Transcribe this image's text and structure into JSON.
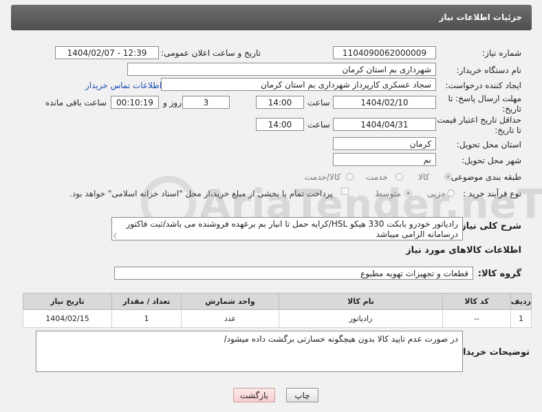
{
  "header": {
    "title": "جزئیات اطلاعات نیاز"
  },
  "watermark": {
    "text": "AriaTender.neT"
  },
  "form": {
    "need_number": {
      "label": "شماره نیاز:",
      "value": "1104090062000009"
    },
    "announce_datetime": {
      "label": "تاریخ و ساعت اعلان عمومی:",
      "value": "1404/02/07 - 12:39"
    },
    "buyer_org": {
      "label": "نام دستگاه خریدار:",
      "value": "شهرداری بم استان کرمان"
    },
    "requester": {
      "label": "ایجاد کننده درخواست:",
      "value": "سجاد عسکری کارپرداز شهرداری بم استان کرمان",
      "contact_link": "اطلاعات تماس خریدار"
    },
    "reply_deadline": {
      "label_line1": "مهلت ارسال پاسخ: تا",
      "label_line2": "تاریخ:",
      "date": "1404/02/10",
      "time_label": "ساعت",
      "time": "14:00",
      "days": "3",
      "days_label": "روز و",
      "remaining": "00:10:19",
      "remaining_label": "ساعت باقی مانده"
    },
    "price_validity": {
      "label_line1": "حداقل تاریخ اعتبار قیمت:",
      "label_line2": "تا تاریخ:",
      "date": "1404/04/31",
      "time_label": "ساعت",
      "time": "14:00"
    },
    "delivery_province": {
      "label": "استان محل تحویل:",
      "value": "کرمان"
    },
    "delivery_city": {
      "label": "شهر محل تحویل:",
      "value": "بم"
    },
    "category": {
      "label": "طبقه بندی موضوعی:",
      "options": [
        "کالا",
        "خدمت",
        "کالا/خدمت"
      ],
      "selected": "کالا"
    },
    "process_type": {
      "label": "نوع فرآیند خرید :",
      "options": [
        "جزیی",
        "متوسط"
      ],
      "selected": "متوسط",
      "payment_note": "پرداخت تمام یا بخشی از مبلغ خرید،از محل \"اسناد خزانه اسلامی\" خواهد بود."
    }
  },
  "description": {
    "label": "شرح کلی نیاز:",
    "value": "رادیاتور خودرو بابکت 330 هیکو HSL/کرایه حمل تا انبار بم برعهده فروشنده می باشد/ثبت فاکتور درسامانه الزامی میباشد"
  },
  "goods_section": {
    "title": "اطلاعات کالاهای مورد نیاز",
    "group_label": "گروه کالا:",
    "group_value": "قطعات و تجهیزات تهویه مطبوع"
  },
  "table": {
    "headers": [
      "ردیف",
      "کد کالا",
      "نام کالا",
      "واحد شمارش",
      "تعداد / مقدار",
      "تاریخ نیاز"
    ],
    "rows": [
      [
        "1",
        "--",
        "رادیاتور",
        "عدد",
        "1",
        "1404/02/15"
      ]
    ]
  },
  "buyer_notes": {
    "label": "توضیحات خریدار:",
    "value": "در صورت عدم تایید کالا بدون هیچگونه خسارتی برگشت داده میشود/"
  },
  "buttons": {
    "print": "چاپ",
    "back": "بازگشت"
  }
}
